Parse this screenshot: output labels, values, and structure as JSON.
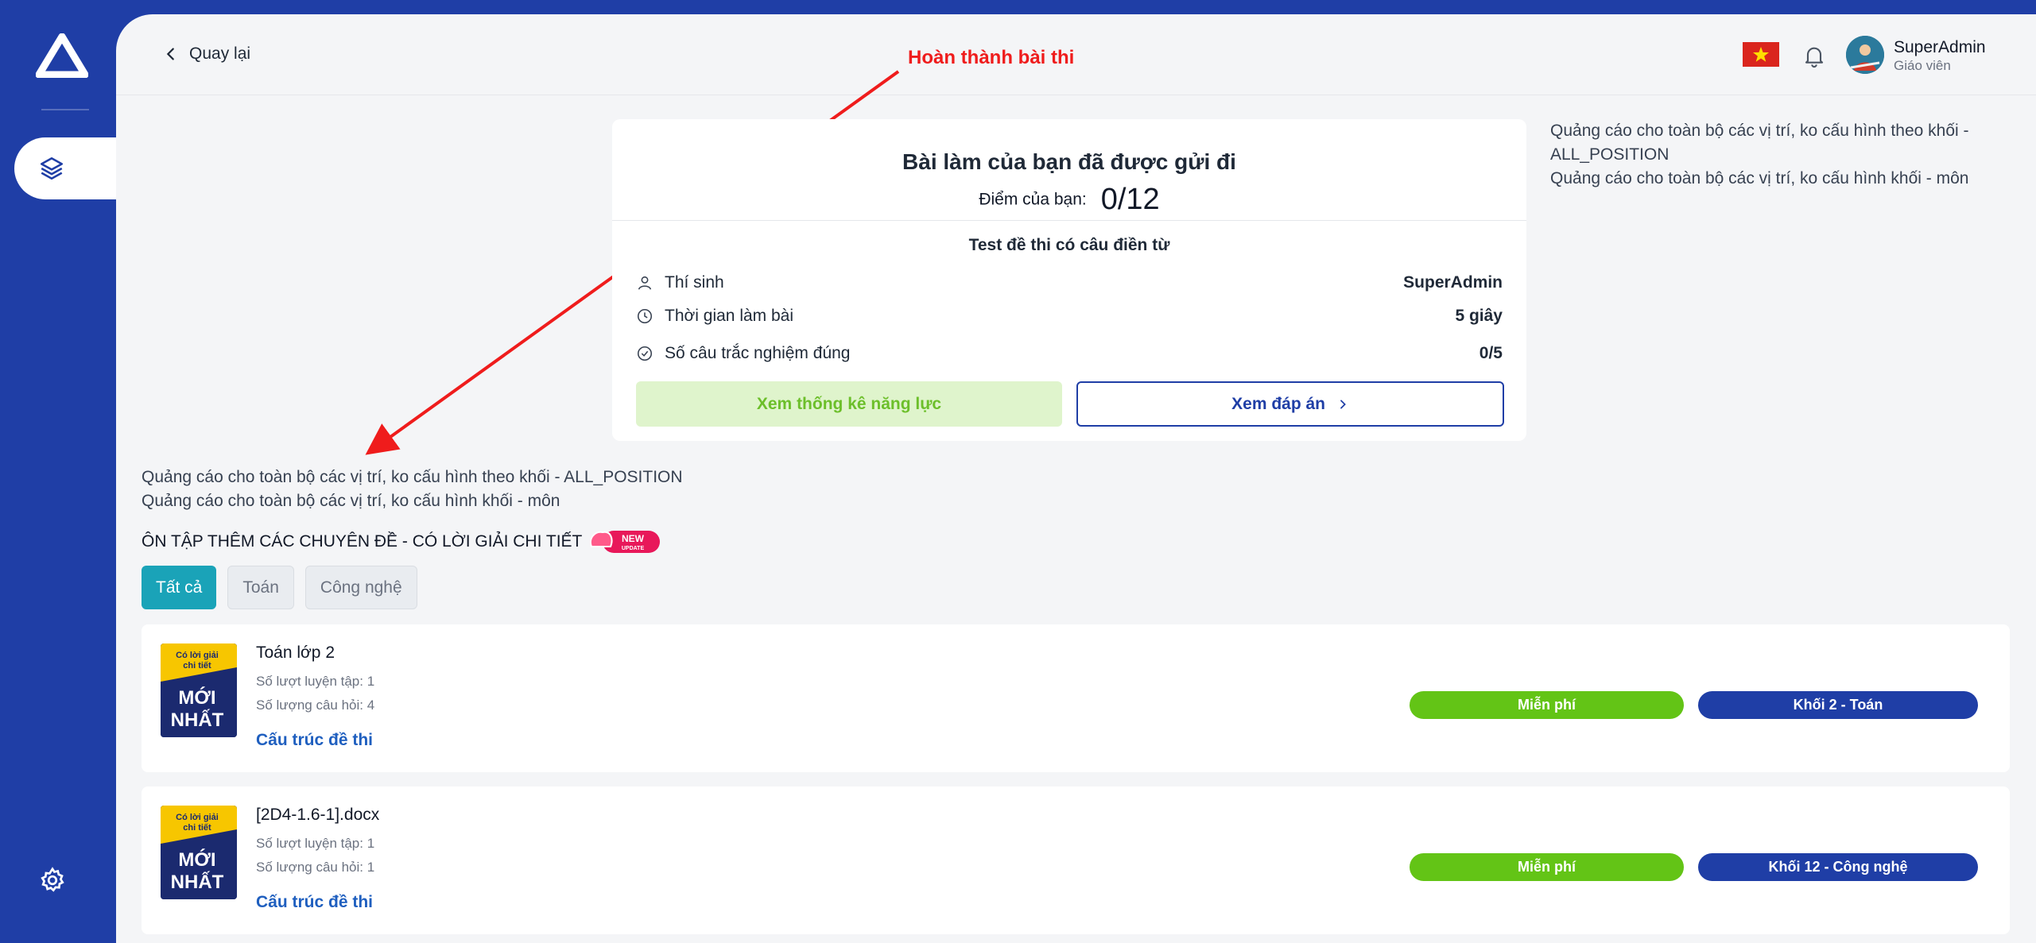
{
  "nav": {
    "back_label": "Quay lại"
  },
  "user": {
    "name": "SuperAdmin",
    "role": "Giáo viên"
  },
  "annotation": "Hoàn thành bài thi",
  "result": {
    "title": "Bài làm của bạn đã được gửi đi",
    "score_label": "Điểm của bạn:",
    "score_value": "0/12",
    "test_name": "Test đề thi có câu điền từ",
    "rows": [
      {
        "label": "Thí sinh",
        "value": "SuperAdmin",
        "icon": "user-icon"
      },
      {
        "label": "Thời gian làm bài",
        "value": "5 giây",
        "icon": "clock-icon"
      },
      {
        "label": "Số câu trắc nghiệm đúng",
        "value": "0/5",
        "icon": "check-circle-icon"
      }
    ],
    "stats_button": "Xem thống kê năng lực",
    "answers_button": "Xem đáp án"
  },
  "ads": {
    "right_line1": "Quảng cáo cho toàn bộ các vị trí, ko cấu hình theo khối - ALL_POSITION",
    "right_line2": "Quảng cáo cho toàn bộ các vị trí, ko cấu hình khối - môn",
    "left_line1": "Quảng cáo cho toàn bộ các vị trí, ko cấu hình theo khối - ALL_POSITION",
    "left_line2": "Quảng cáo cho toàn bộ các vị trí, ko cấu hình khối - môn"
  },
  "section": {
    "title": "ÔN TẬP THÊM CÁC CHUYÊN ĐỀ - CÓ LỜI GIẢI CHI TIẾT",
    "badge_text": "NEW",
    "badge_sub": "UPDATE"
  },
  "filters": [
    "Tất cả",
    "Toán",
    "Công nghệ"
  ],
  "thumb": {
    "ribbon_line1": "Có lời giải",
    "ribbon_line2": "chi tiết",
    "big_line1": "MỚI",
    "big_line2": "NHẤT"
  },
  "exams": [
    {
      "title": "Toán lớp 2",
      "practice": "Số lượt luyện tập: 1",
      "questions": "Số lượng câu hỏi: 4",
      "link": "Cấu trúc đề thi",
      "price": "Miễn phí",
      "grade": "Khối 2 - Toán"
    },
    {
      "title": "[2D4-1.6-1].docx",
      "practice": "Số lượt luyện tập: 1",
      "questions": "Số lượng câu hỏi: 1",
      "link": "Cấu trúc đề thi",
      "price": "Miễn phí",
      "grade": "Khối 12 - Công nghệ"
    }
  ],
  "colors": {
    "brand": "#1f3ea6",
    "accent": "#1aa3b8",
    "free": "#63c416",
    "annotation": "#ef1c1c"
  }
}
